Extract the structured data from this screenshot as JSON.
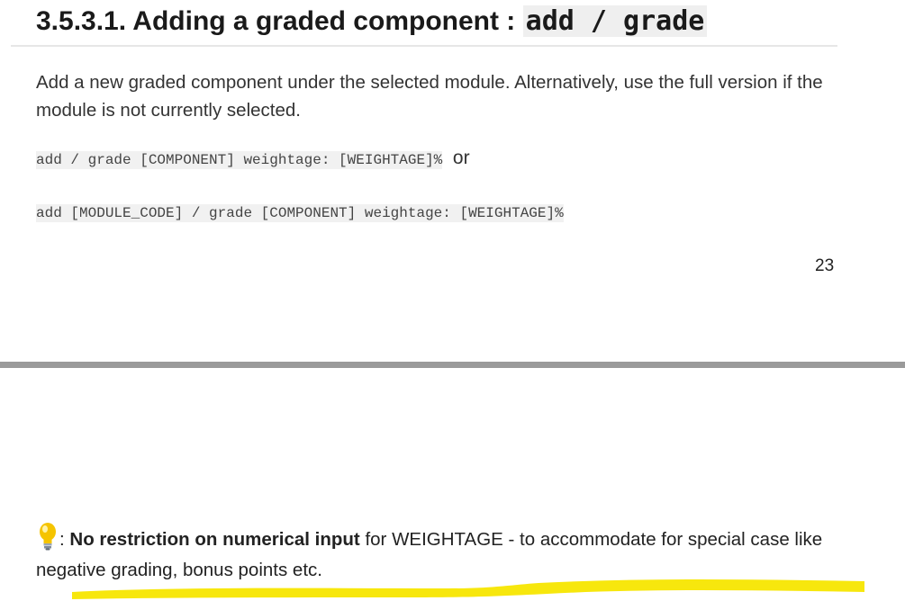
{
  "section": {
    "title_prefix": "3.5.3.1. Adding a graded component : ",
    "title_command": "add / grade"
  },
  "description": "Add a new graded component under the selected module. Alternatively, use the full version if the module is not currently selected.",
  "commands": {
    "short_form": "add / grade [COMPONENT] weightage: [WEIGHTAGE]%",
    "separator": "or",
    "full_form": "add [MODULE_CODE] / grade [COMPONENT] weightage: [WEIGHTAGE]%"
  },
  "page_number": "23",
  "tip": {
    "icon": "lightbulb-icon",
    "prefix": ": ",
    "bold_text": "No restriction on numerical input",
    "rest_text": " for WEIGHTAGE - to accommodate for special case like negative grading, bonus points etc."
  },
  "colors": {
    "highlight": "#f7e600",
    "bulb": "#f5c400",
    "divider": "#9a9a9a"
  }
}
